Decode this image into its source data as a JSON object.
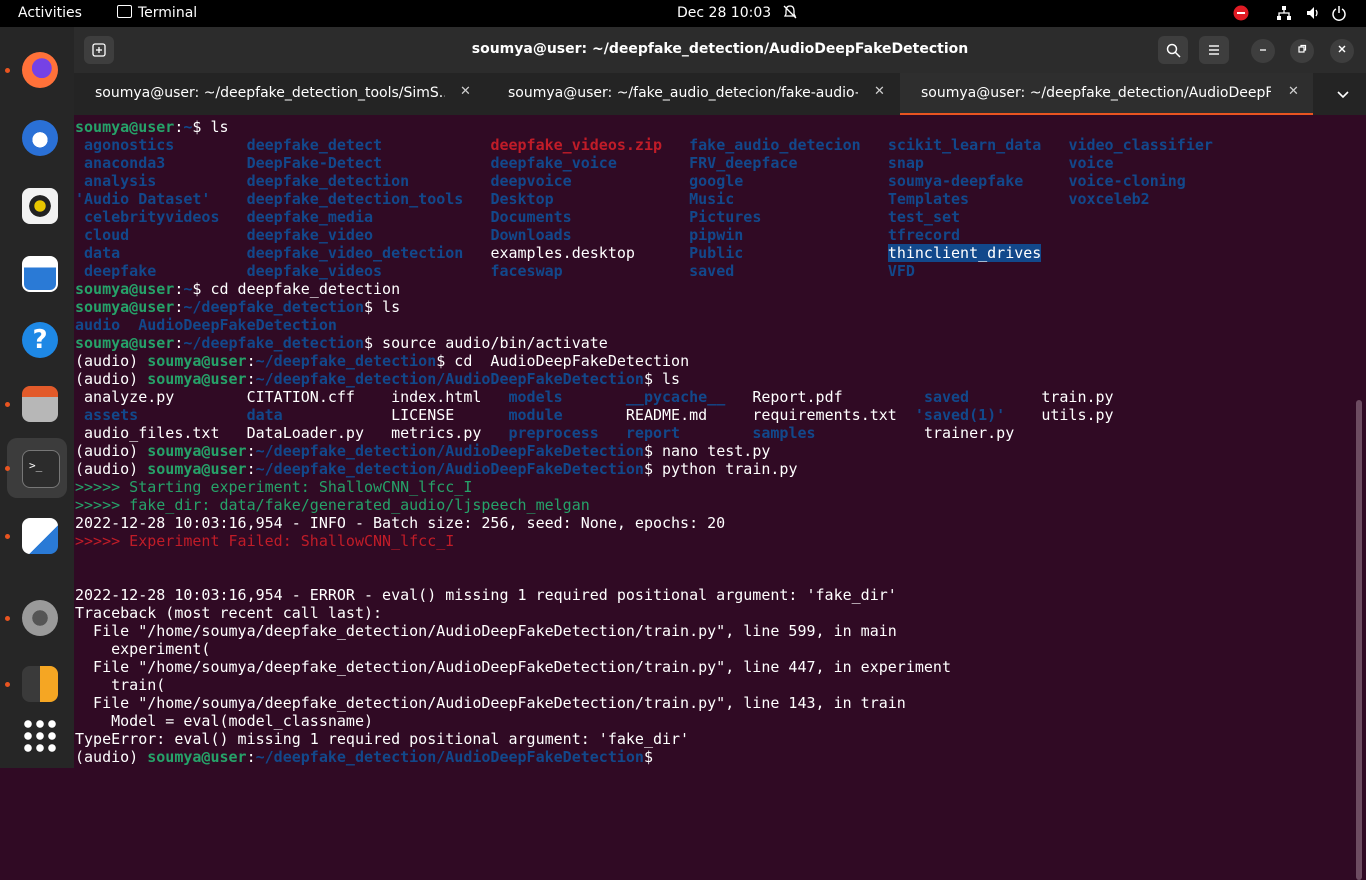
{
  "topbar": {
    "activities": "Activities",
    "app_name": "Terminal",
    "clock": "Dec 28  10:03"
  },
  "window": {
    "title": "soumya@user: ~/deepfake_detection/AudioDeepFakeDetection"
  },
  "tabs": [
    {
      "label": "soumya@user: ~/deepfake_detection_tools/SimS..."
    },
    {
      "label": "soumya@user: ~/fake_audio_detecion/fake-audio-..."
    },
    {
      "label": "soumya@user: ~/deepfake_detection/AudioDeepF..."
    }
  ],
  "colors": {
    "accent": "#e95420",
    "background": "#300a24",
    "dir_blue": "#12488b",
    "prompt_green": "#26a269",
    "error_red": "#c01c28"
  },
  "terminal": {
    "lines": [
      [
        {
          "t": "soumya@user",
          "s": "u"
        },
        {
          "t": ":",
          "s": "w"
        },
        {
          "t": "~",
          "s": "p"
        },
        {
          "t": "$ ls",
          "s": "w"
        }
      ],
      [
        {
          "c": 1,
          "t": "agonostics",
          "s": "d"
        },
        {
          "c": 19,
          "t": "deepfake_detect",
          "s": "d"
        },
        {
          "c": 46,
          "t": "deepfake_videos.zip",
          "s": "r"
        },
        {
          "c": 68,
          "t": "fake_audio_detecion",
          "s": "d"
        },
        {
          "c": 90,
          "t": "scikit_learn_data",
          "s": "d"
        },
        {
          "c": 110,
          "t": "video_classifier",
          "s": "d"
        }
      ],
      [
        {
          "c": 1,
          "t": "anaconda3",
          "s": "d"
        },
        {
          "c": 19,
          "t": "DeepFake-Detect",
          "s": "d"
        },
        {
          "c": 46,
          "t": "deepfake_voice",
          "s": "d"
        },
        {
          "c": 68,
          "t": "FRV_deepface",
          "s": "d"
        },
        {
          "c": 90,
          "t": "snap",
          "s": "d"
        },
        {
          "c": 110,
          "t": "voice",
          "s": "d"
        }
      ],
      [
        {
          "c": 1,
          "t": "analysis",
          "s": "d"
        },
        {
          "c": 19,
          "t": "deepfake_detection",
          "s": "d"
        },
        {
          "c": 46,
          "t": "deepvoice",
          "s": "d"
        },
        {
          "c": 68,
          "t": "google",
          "s": "d"
        },
        {
          "c": 90,
          "t": "soumya-deepfake",
          "s": "d"
        },
        {
          "c": 110,
          "t": "voice-cloning",
          "s": "d"
        }
      ],
      [
        {
          "c": 0,
          "t": "'Audio Dataset'",
          "s": "d"
        },
        {
          "c": 19,
          "t": "deepfake_detection_tools",
          "s": "d"
        },
        {
          "c": 46,
          "t": "Desktop",
          "s": "d"
        },
        {
          "c": 68,
          "t": "Music",
          "s": "d"
        },
        {
          "c": 90,
          "t": "Templates",
          "s": "d"
        },
        {
          "c": 110,
          "t": "voxceleb2",
          "s": "d"
        }
      ],
      [
        {
          "c": 1,
          "t": "celebrityvideos",
          "s": "d"
        },
        {
          "c": 19,
          "t": "deepfake_media",
          "s": "d"
        },
        {
          "c": 46,
          "t": "Documents",
          "s": "d"
        },
        {
          "c": 68,
          "t": "Pictures",
          "s": "d"
        },
        {
          "c": 90,
          "t": "test_set",
          "s": "d"
        }
      ],
      [
        {
          "c": 1,
          "t": "cloud",
          "s": "d"
        },
        {
          "c": 19,
          "t": "deepfake_video",
          "s": "d"
        },
        {
          "c": 46,
          "t": "Downloads",
          "s": "d"
        },
        {
          "c": 68,
          "t": "pipwin",
          "s": "d"
        },
        {
          "c": 90,
          "t": "tfrecord",
          "s": "d"
        }
      ],
      [
        {
          "c": 1,
          "t": "data",
          "s": "d"
        },
        {
          "c": 19,
          "t": "deepfake_video_detection",
          "s": "d"
        },
        {
          "c": 46,
          "t": "examples.desktop",
          "s": "w"
        },
        {
          "c": 68,
          "t": "Public",
          "s": "d"
        },
        {
          "c": 90,
          "t": "thinclient_drives",
          "s": "hl"
        }
      ],
      [
        {
          "c": 1,
          "t": "deepfake",
          "s": "d"
        },
        {
          "c": 19,
          "t": "deepfake_videos",
          "s": "d"
        },
        {
          "c": 46,
          "t": "faceswap",
          "s": "d"
        },
        {
          "c": 68,
          "t": "saved",
          "s": "d"
        },
        {
          "c": 90,
          "t": "VFD",
          "s": "d"
        }
      ],
      [
        {
          "t": "soumya@user",
          "s": "u"
        },
        {
          "t": ":",
          "s": "w"
        },
        {
          "t": "~",
          "s": "p"
        },
        {
          "t": "$ cd deepfake_detection",
          "s": "w"
        }
      ],
      [
        {
          "t": "soumya@user",
          "s": "u"
        },
        {
          "t": ":",
          "s": "w"
        },
        {
          "t": "~/deepfake_detection",
          "s": "p"
        },
        {
          "t": "$ ls",
          "s": "w"
        }
      ],
      [
        {
          "t": "audio",
          "s": "d"
        },
        {
          "t": "  ",
          "s": "w"
        },
        {
          "t": "AudioDeepFakeDetection",
          "s": "d"
        }
      ],
      [
        {
          "t": "soumya@user",
          "s": "u"
        },
        {
          "t": ":",
          "s": "w"
        },
        {
          "t": "~/deepfake_detection",
          "s": "p"
        },
        {
          "t": "$ source audio/bin/activate",
          "s": "w"
        }
      ],
      [
        {
          "t": "(audio) ",
          "s": "w"
        },
        {
          "t": "soumya@user",
          "s": "u"
        },
        {
          "t": ":",
          "s": "w"
        },
        {
          "t": "~/deepfake_detection",
          "s": "p"
        },
        {
          "t": "$ cd  AudioDeepFakeDetection",
          "s": "w"
        }
      ],
      [
        {
          "t": "(audio) ",
          "s": "w"
        },
        {
          "t": "soumya@user",
          "s": "u"
        },
        {
          "t": ":",
          "s": "w"
        },
        {
          "t": "~/deepfake_detection/AudioDeepFakeDetection",
          "s": "p"
        },
        {
          "t": "$ ls",
          "s": "w"
        }
      ],
      [
        {
          "c": 1,
          "t": "analyze.py",
          "s": "w"
        },
        {
          "c": 19,
          "t": "CITATION.cff",
          "s": "w"
        },
        {
          "c": 35,
          "t": "index.html",
          "s": "w"
        },
        {
          "c": 48,
          "t": "models",
          "s": "d"
        },
        {
          "c": 61,
          "t": "__pycache__",
          "s": "d"
        },
        {
          "c": 75,
          "t": "Report.pdf",
          "s": "w"
        },
        {
          "c": 94,
          "t": "saved",
          "s": "d"
        },
        {
          "c": 107,
          "t": "train.py",
          "s": "w"
        }
      ],
      [
        {
          "c": 1,
          "t": "assets",
          "s": "d"
        },
        {
          "c": 19,
          "t": "data",
          "s": "d"
        },
        {
          "c": 35,
          "t": "LICENSE",
          "s": "w"
        },
        {
          "c": 48,
          "t": "module",
          "s": "d"
        },
        {
          "c": 61,
          "t": "README.md",
          "s": "w"
        },
        {
          "c": 75,
          "t": "requirements.txt",
          "s": "w"
        },
        {
          "c": 93,
          "t": "'saved(1)'",
          "s": "d"
        },
        {
          "c": 107,
          "t": "utils.py",
          "s": "w"
        }
      ],
      [
        {
          "c": 1,
          "t": "audio_files.txt",
          "s": "w"
        },
        {
          "c": 19,
          "t": "DataLoader.py",
          "s": "w"
        },
        {
          "c": 35,
          "t": "metrics.py",
          "s": "w"
        },
        {
          "c": 48,
          "t": "preprocess",
          "s": "d"
        },
        {
          "c": 61,
          "t": "report",
          "s": "d"
        },
        {
          "c": 75,
          "t": "samples",
          "s": "d"
        },
        {
          "c": 94,
          "t": "trainer.py",
          "s": "w"
        }
      ],
      [
        {
          "t": "(audio) ",
          "s": "w"
        },
        {
          "t": "soumya@user",
          "s": "u"
        },
        {
          "t": ":",
          "s": "w"
        },
        {
          "t": "~/deepfake_detection/AudioDeepFakeDetection",
          "s": "p"
        },
        {
          "t": "$ nano test.py",
          "s": "w"
        }
      ],
      [
        {
          "t": "(audio) ",
          "s": "w"
        },
        {
          "t": "soumya@user",
          "s": "u"
        },
        {
          "t": ":",
          "s": "w"
        },
        {
          "t": "~/deepfake_detection/AudioDeepFakeDetection",
          "s": "p"
        },
        {
          "t": "$ python train.py",
          "s": "w"
        }
      ],
      [
        {
          "t": ">>>>> Starting experiment: ShallowCNN_lfcc_I",
          "s": "g"
        }
      ],
      [
        {
          "t": ">>>>> fake_dir: data/fake/generated_audio/ljspeech_melgan",
          "s": "g"
        }
      ],
      [
        {
          "t": "2022-12-28 10:03:16,954 - INFO - Batch size: 256, seed: None, epochs: 20",
          "s": "w"
        }
      ],
      [
        {
          "t": ">>>>> Experiment Failed: ShallowCNN_lfcc_I",
          "s": "rd"
        }
      ],
      [],
      [],
      [
        {
          "t": "2022-12-28 10:03:16,954 - ERROR - eval() missing 1 required positional argument: 'fake_dir'",
          "s": "w"
        }
      ],
      [
        {
          "t": "Traceback (most recent call last):",
          "s": "w"
        }
      ],
      [
        {
          "t": "  File \"/home/soumya/deepfake_detection/AudioDeepFakeDetection/train.py\", line 599, in main",
          "s": "w"
        }
      ],
      [
        {
          "t": "    experiment(",
          "s": "w"
        }
      ],
      [
        {
          "t": "  File \"/home/soumya/deepfake_detection/AudioDeepFakeDetection/train.py\", line 447, in experiment",
          "s": "w"
        }
      ],
      [
        {
          "t": "    train(",
          "s": "w"
        }
      ],
      [
        {
          "t": "  File \"/home/soumya/deepfake_detection/AudioDeepFakeDetection/train.py\", line 143, in train",
          "s": "w"
        }
      ],
      [
        {
          "t": "    Model = eval(model_classname)",
          "s": "w"
        }
      ],
      [
        {
          "t": "TypeError: eval() missing 1 required positional argument: 'fake_dir'",
          "s": "w"
        }
      ],
      [
        {
          "t": "(audio) ",
          "s": "w"
        },
        {
          "t": "soumya@user",
          "s": "u"
        },
        {
          "t": ":",
          "s": "w"
        },
        {
          "t": "~/deepfake_detection/AudioDeepFakeDetection",
          "s": "p"
        },
        {
          "t": "$",
          "s": "w"
        }
      ]
    ]
  },
  "dock": [
    {
      "name": "firefox-icon",
      "color": "#ff7139",
      "running": true
    },
    {
      "name": "thunderbird-icon",
      "color": "#2a70d6",
      "running": false
    },
    {
      "name": "rhythmbox-icon",
      "color": "#e8c600",
      "running": false
    },
    {
      "name": "libreoffice-writer-icon",
      "color": "#2a7ad6",
      "running": false
    },
    {
      "name": "help-icon",
      "color": "#1e88e5",
      "running": false
    },
    {
      "name": "files-icon",
      "color": "#d35a2a",
      "running": true
    },
    {
      "name": "terminal-icon",
      "color": "#2c2c2c",
      "running": true
    },
    {
      "name": "text-editor-icon",
      "color": "#f4f4f4",
      "running": true
    },
    {
      "name": "settings-icon",
      "color": "#9a9a9a",
      "running": true
    },
    {
      "name": "calculator-icon",
      "color": "#f5a623",
      "running": true
    },
    {
      "name": "show-apps-icon",
      "color": "#ffffff",
      "running": false
    }
  ]
}
